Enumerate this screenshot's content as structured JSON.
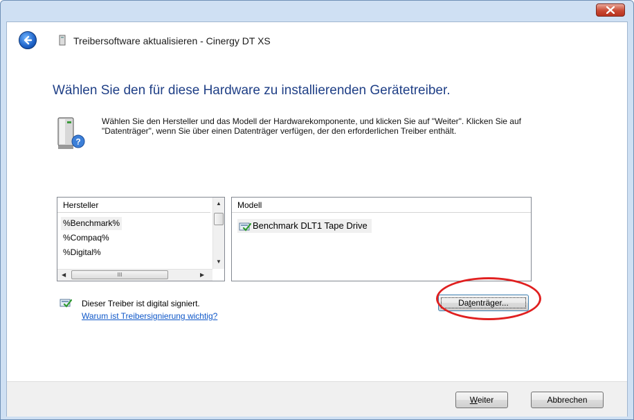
{
  "window": {
    "title": "Treibersoftware aktualisieren - Cinergy DT XS"
  },
  "page": {
    "heading": "Wählen Sie den für diese Hardware zu installierenden Gerätetreiber.",
    "instructions": "Wählen Sie den Hersteller und das Modell der Hardwarekomponente, und klicken Sie auf \"Weiter\". Klicken Sie auf \"Datenträger\", wenn Sie über einen Datenträger verfügen, der den erforderlichen Treiber enthält."
  },
  "manufacturer_list": {
    "header": "Hersteller",
    "items": [
      "%Benchmark%",
      "%Compaq%",
      "%Digital%"
    ],
    "selected_index": 0,
    "hscroll_thumb_glyph": "III"
  },
  "model_list": {
    "header": "Modell",
    "items": [
      "Benchmark DLT1 Tape Drive"
    ]
  },
  "signature": {
    "status_text": "Dieser Treiber ist digital signiert.",
    "link_text": "Warum ist Treibersignierung wichtig?"
  },
  "buttons": {
    "disk_label_pre": "Da",
    "disk_label_accel": "t",
    "disk_label_post": "enträger...",
    "next_label_accel": "W",
    "next_label_post": "eiter",
    "cancel_label": "Abbrechen"
  },
  "colors": {
    "heading_blue": "#1f3f86",
    "link_blue": "#0d56c8",
    "highlight_red": "#e02020",
    "close_button_red": "#c94a34"
  },
  "icons": {
    "back": "back-arrow-icon",
    "close": "close-icon",
    "device": "device-icon",
    "hardware_help": "hardware-help-icon",
    "signed_driver": "signed-driver-icon"
  }
}
